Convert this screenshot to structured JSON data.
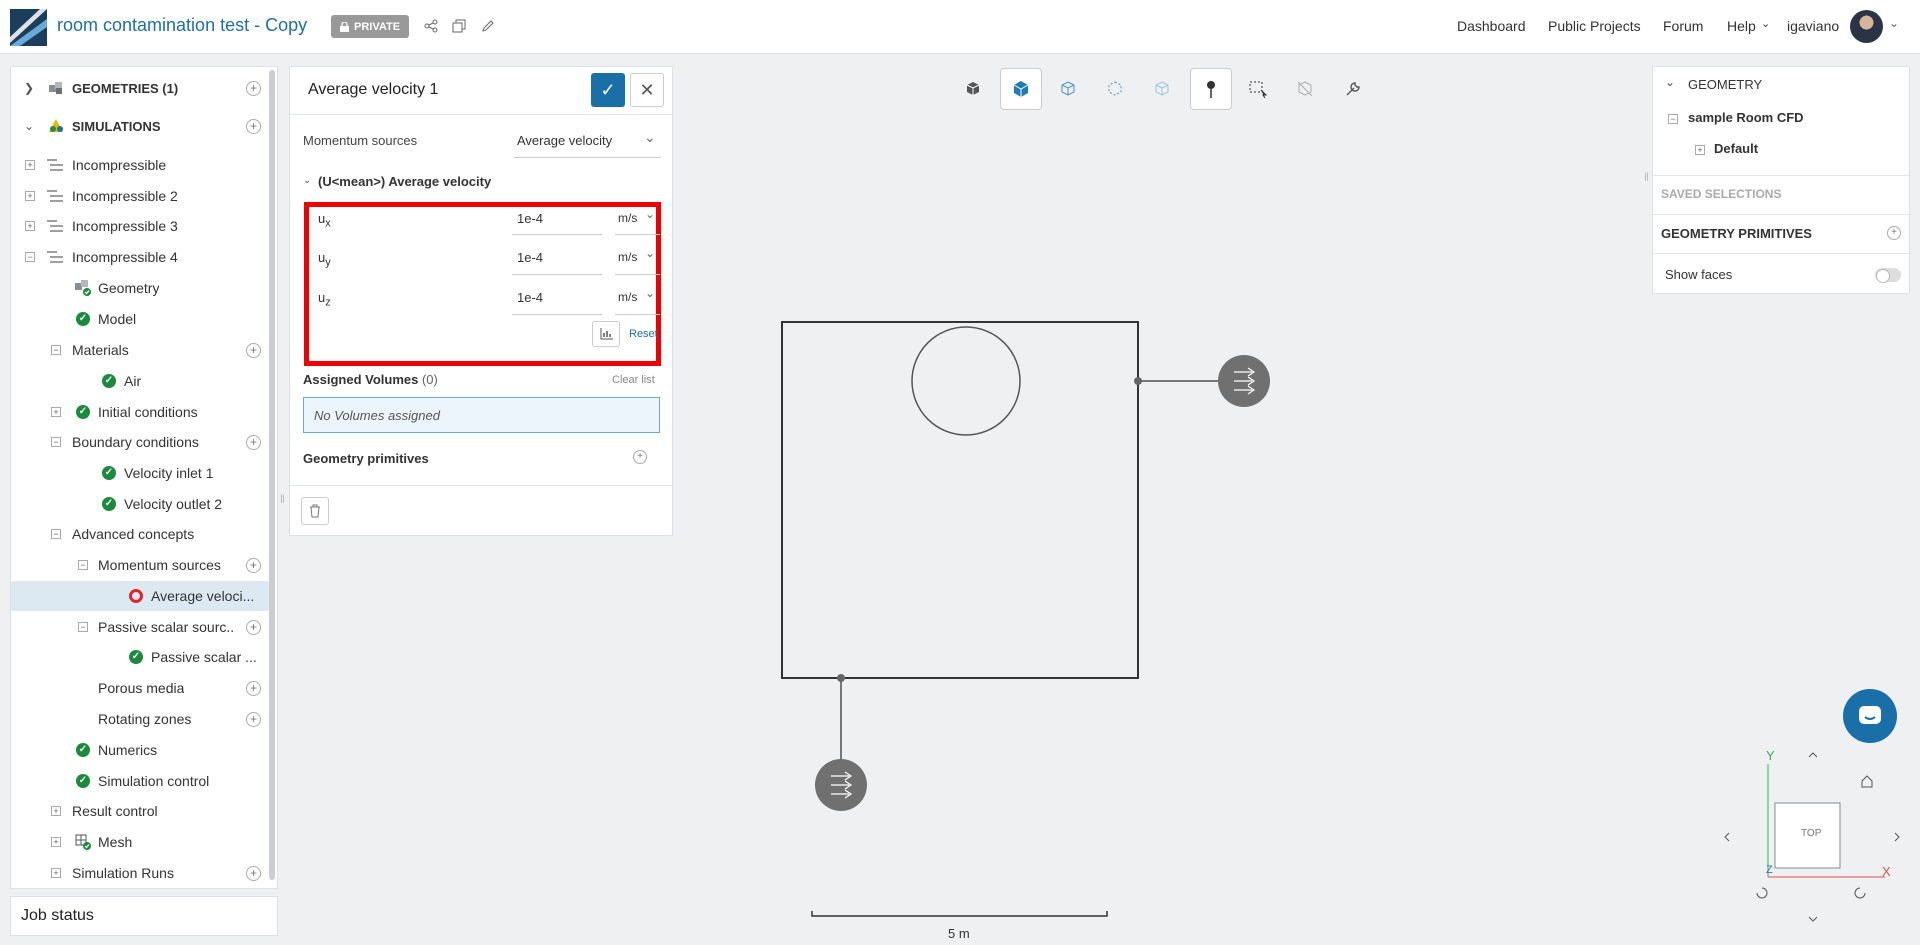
{
  "header": {
    "title": "room contamination test - Copy",
    "private_label": "PRIVATE",
    "nav": [
      "Dashboard",
      "Public Projects",
      "Forum",
      "Help"
    ],
    "username": "igaviano"
  },
  "tree": {
    "geometries": "GEOMETRIES (1)",
    "simulations": "SIMULATIONS",
    "items": [
      "Incompressible",
      "Incompressible 2",
      "Incompressible 3",
      "Incompressible 4"
    ],
    "children": {
      "geometry": "Geometry",
      "model": "Model",
      "materials": "Materials",
      "air": "Air",
      "initial_conditions": "Initial conditions",
      "boundary_conditions": "Boundary conditions",
      "velocity_inlet": "Velocity inlet 1",
      "velocity_outlet": "Velocity outlet 2",
      "advanced_concepts": "Advanced concepts",
      "momentum_sources": "Momentum sources",
      "average_velocity": "Average veloci...",
      "passive_scalar_sources": "Passive scalar sourc...",
      "passive_scalar": "Passive scalar ...",
      "porous_media": "Porous media",
      "rotating_zones": "Rotating zones",
      "numerics": "Numerics",
      "simulation_control": "Simulation control",
      "result_control": "Result control",
      "mesh": "Mesh",
      "simulation_runs": "Simulation Runs"
    },
    "job_status": "Job status"
  },
  "panel": {
    "title": "Average velocity 1",
    "type_label": "Momentum sources",
    "type_value": "Average velocity",
    "section": "(U<mean>) Average velocity",
    "fields": [
      {
        "name": "u",
        "sub": "x",
        "value": "1e-4",
        "unit": "m/s"
      },
      {
        "name": "u",
        "sub": "y",
        "value": "1e-4",
        "unit": "m/s"
      },
      {
        "name": "u",
        "sub": "z",
        "value": "1e-4",
        "unit": "m/s"
      }
    ],
    "reset": "Reset",
    "assigned_label": "Assigned Volumes",
    "assigned_count": "(0)",
    "clear_list": "Clear list",
    "no_volumes": "No Volumes assigned",
    "geometry_primitives": "Geometry primitives"
  },
  "right": {
    "geometry": "GEOMETRY",
    "model": "sample Room CFD",
    "default": "Default",
    "saved_selections": "SAVED SELECTIONS",
    "geometry_primitives": "GEOMETRY PRIMITIVES",
    "show_faces": "Show faces"
  },
  "viewport": {
    "scale": "5 m",
    "view_label": "TOP",
    "axes": {
      "x": "X",
      "y": "Y",
      "z": "Z"
    }
  },
  "colors": {
    "accent": "#1b6fa8",
    "success": "#1b8a3d",
    "highlight": "#ee0000"
  }
}
